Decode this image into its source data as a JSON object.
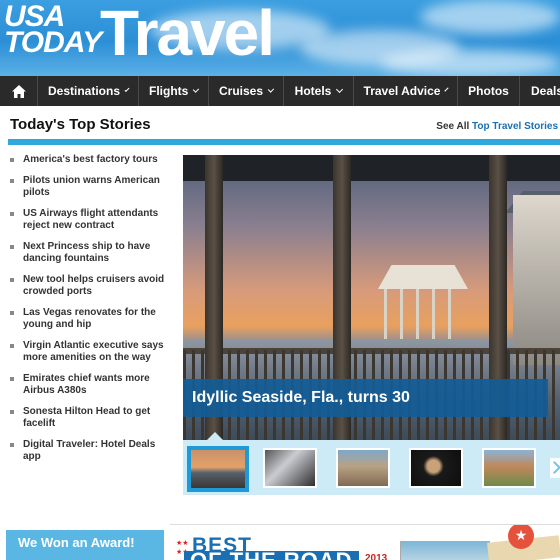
{
  "header": {
    "logo_line1": "USA",
    "logo_line2": "TODAY",
    "section": "Travel"
  },
  "nav": {
    "home_icon": "home-icon",
    "items": [
      {
        "label": "Destinations",
        "has_dropdown": true
      },
      {
        "label": "Flights",
        "has_dropdown": true
      },
      {
        "label": "Cruises",
        "has_dropdown": true
      },
      {
        "label": "Hotels",
        "has_dropdown": true
      },
      {
        "label": "Travel Advice",
        "has_dropdown": true
      },
      {
        "label": "Photos",
        "has_dropdown": false
      },
      {
        "label": "Deals",
        "has_dropdown": false
      }
    ]
  },
  "top_stories": {
    "title": "Today's Top Stories",
    "see_all_prefix": "See All",
    "see_all_link": "Top Travel Stories",
    "items": [
      "America's best factory tours",
      "Pilots union warns American pilots",
      "US Airways flight attendants reject new contract",
      "Next Princess ship to have dancing fountains",
      "New tool helps cruisers avoid crowded ports",
      "Las Vegas renovates for the young and hip",
      "Virgin Atlantic executive says more amenities on the way",
      "Emirates chief wants more Airbus A380s",
      "Sonesta Hilton Head to get facelift",
      "Digital Traveler: Hotel Deals app"
    ]
  },
  "hero": {
    "caption": "Idyllic Seaside, Fla., turns 30",
    "thumbnails": 5,
    "active_thumbnail": 1
  },
  "bottom": {
    "award_label": "We Won an Award!",
    "promo_line1": "BEST",
    "promo_line2": "OF THE ROAD",
    "promo_year": "2013"
  },
  "colors": {
    "accent_blue": "#2fa8dc",
    "link_blue": "#1a6fb3",
    "nav_bg": "#2a2a2a",
    "caption_bg": "#125c96"
  }
}
